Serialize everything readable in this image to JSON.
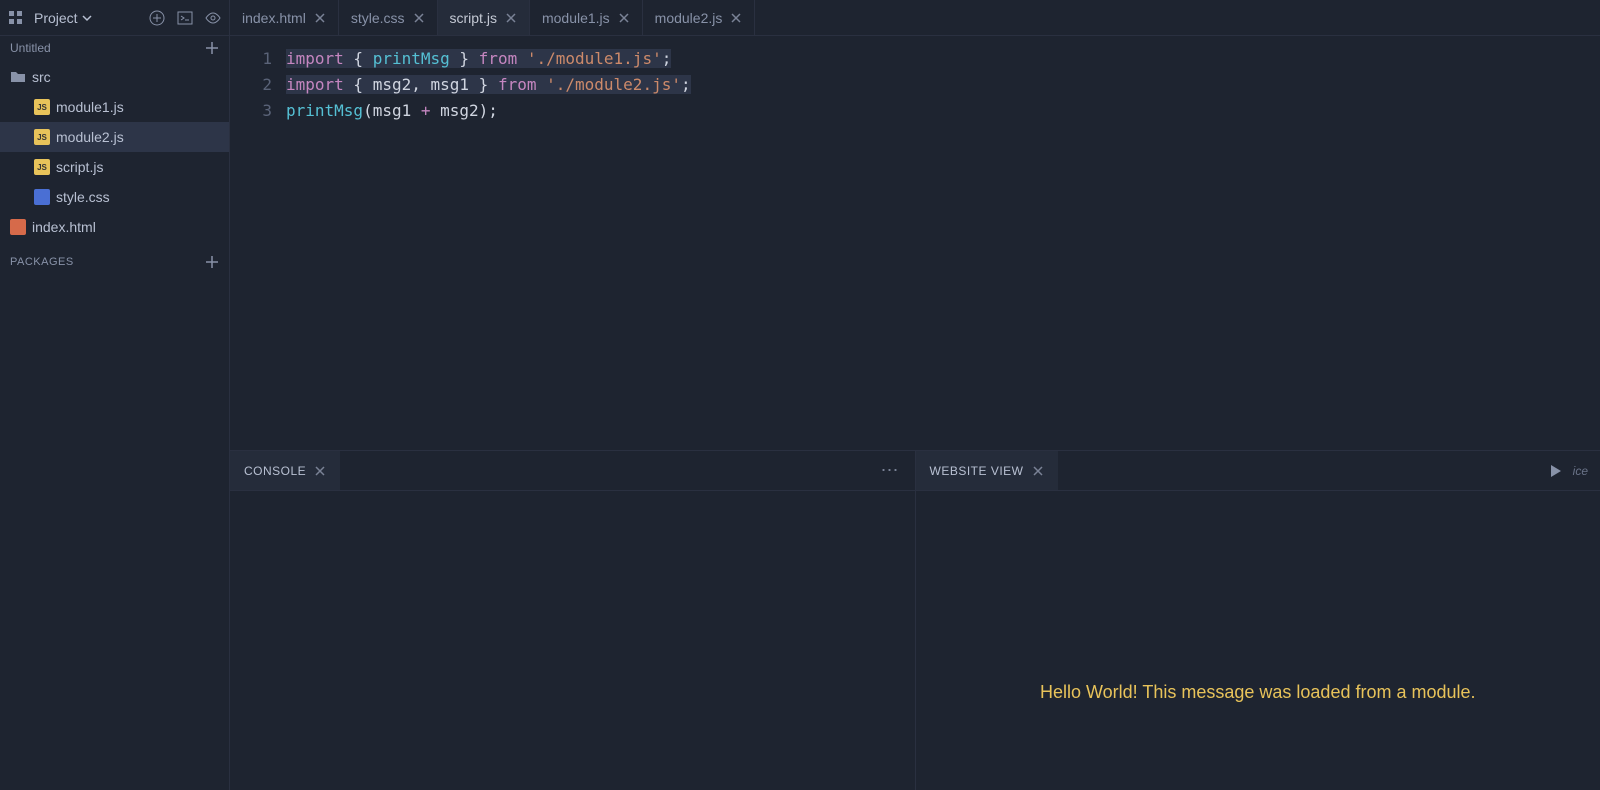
{
  "titlebar": {
    "project_label": "Project"
  },
  "sidebar": {
    "title": "Untitled",
    "packages_label": "PACKAGES",
    "tree": [
      {
        "name": "src",
        "type": "folder",
        "indent": 0,
        "selected": false
      },
      {
        "name": "module1.js",
        "type": "js",
        "indent": 1,
        "selected": false
      },
      {
        "name": "module2.js",
        "type": "js",
        "indent": 1,
        "selected": true
      },
      {
        "name": "script.js",
        "type": "js",
        "indent": 1,
        "selected": false
      },
      {
        "name": "style.css",
        "type": "css",
        "indent": 1,
        "selected": false
      },
      {
        "name": "index.html",
        "type": "html",
        "indent": 0,
        "selected": false
      }
    ]
  },
  "tabs": [
    {
      "label": "index.html",
      "active": false
    },
    {
      "label": "style.css",
      "active": false
    },
    {
      "label": "script.js",
      "active": true
    },
    {
      "label": "module1.js",
      "active": false
    },
    {
      "label": "module2.js",
      "active": false
    }
  ],
  "editor": {
    "gutter": [
      "1",
      "2",
      "3"
    ],
    "lines": [
      [
        {
          "t": "import",
          "c": "tk-kw",
          "hl": true
        },
        {
          "t": " { ",
          "c": "tk-punct",
          "hl": true
        },
        {
          "t": "printMsg",
          "c": "tk-fn",
          "hl": true
        },
        {
          "t": " } ",
          "c": "tk-punct",
          "hl": true
        },
        {
          "t": "from",
          "c": "tk-kw",
          "hl": true
        },
        {
          "t": " ",
          "c": "tk-punct",
          "hl": true
        },
        {
          "t": "'./module1.js'",
          "c": "tk-str",
          "hl": true
        },
        {
          "t": ";",
          "c": "tk-punct",
          "hl": true
        }
      ],
      [
        {
          "t": "import",
          "c": "tk-kw",
          "hl": true
        },
        {
          "t": " { ",
          "c": "tk-punct",
          "hl": true
        },
        {
          "t": "msg2",
          "c": "tk-var",
          "hl": true
        },
        {
          "t": ", ",
          "c": "tk-punct",
          "hl": true
        },
        {
          "t": "msg1",
          "c": "tk-var",
          "hl": true
        },
        {
          "t": " } ",
          "c": "tk-punct",
          "hl": true
        },
        {
          "t": "from",
          "c": "tk-kw",
          "hl": true
        },
        {
          "t": " ",
          "c": "tk-punct",
          "hl": true
        },
        {
          "t": "'./module2.js'",
          "c": "tk-str",
          "hl": true
        },
        {
          "t": ";",
          "c": "tk-punct",
          "hl": true
        }
      ],
      [
        {
          "t": "printMsg",
          "c": "tk-fn",
          "hl": false
        },
        {
          "t": "(",
          "c": "tk-punct",
          "hl": false
        },
        {
          "t": "msg1",
          "c": "tk-var",
          "hl": false
        },
        {
          "t": " + ",
          "c": "tk-op",
          "hl": false
        },
        {
          "t": "msg2",
          "c": "tk-var",
          "hl": false
        },
        {
          "t": ");",
          "c": "tk-punct",
          "hl": false
        }
      ]
    ]
  },
  "panels": {
    "console_label": "CONSOLE",
    "website_label": "WEBSITE VIEW",
    "brand": "ice",
    "preview_text": "Hello World! This message was loaded from a module."
  }
}
